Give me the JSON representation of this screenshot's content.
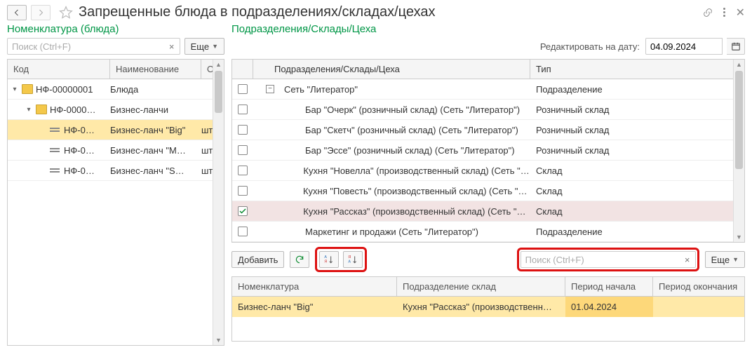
{
  "header": {
    "title": "Запрещенные блюда в подразделениях/складах/цехах"
  },
  "sections": {
    "left": "Номенклатура (блюда)",
    "right": "Подразделения/Склады/Цеха"
  },
  "search": {
    "placeholder": "Поиск (Ctrl+F)",
    "clear": "×"
  },
  "more_label": "Еще",
  "date_edit": {
    "label": "Редактировать на дату:",
    "value": "04.09.2024"
  },
  "left_grid": {
    "headers": {
      "code": "Код",
      "name": "Наименование",
      "unit": "Осн"
    },
    "rows": [
      {
        "indent": 0,
        "exp": "▾",
        "icon": "folder",
        "code": "НФ-00000001",
        "name": "Блюда",
        "unit": ""
      },
      {
        "indent": 1,
        "exp": "▾",
        "icon": "folder",
        "code": "НФ-0000…",
        "name": "Бизнес-ланчи",
        "unit": ""
      },
      {
        "indent": 2,
        "exp": "",
        "icon": "item",
        "code": "НФ-0…",
        "name": "Бизнес-ланч \"Big\"",
        "unit": "шт",
        "selected": true
      },
      {
        "indent": 2,
        "exp": "",
        "icon": "item",
        "code": "НФ-0…",
        "name": "Бизнес-ланч \"M…",
        "unit": "шт"
      },
      {
        "indent": 2,
        "exp": "",
        "icon": "item",
        "code": "НФ-0…",
        "name": "Бизнес-ланч \"S…",
        "unit": "шт"
      }
    ]
  },
  "upper_grid": {
    "headers": {
      "name": "Подразделения/Склады/Цеха",
      "type": "Тип"
    },
    "rows": [
      {
        "checked": false,
        "header": true,
        "indent": 0,
        "name": "Сеть \"Литератор\"",
        "type": "Подразделение"
      },
      {
        "checked": false,
        "indent": 1,
        "name": "Бар \"Очерк\" (розничный склад)  (Сеть \"Литератор\")",
        "type": "Розничный склад"
      },
      {
        "checked": false,
        "indent": 1,
        "name": "Бар \"Скетч\" (розничный склад)  (Сеть \"Литератор\")",
        "type": "Розничный склад"
      },
      {
        "checked": false,
        "indent": 1,
        "name": "Бар \"Эссе\" (розничный склад)  (Сеть \"Литератор\")",
        "type": "Розничный склад"
      },
      {
        "checked": false,
        "indent": 1,
        "name": "Кухня \"Новелла\" (производственный склад)  (Сеть \"Ли…",
        "type": "Склад"
      },
      {
        "checked": false,
        "indent": 1,
        "name": "Кухня \"Повесть\" (производственный склад)  (Сеть \"Лит…",
        "type": "Склад"
      },
      {
        "checked": true,
        "indent": 1,
        "name": "Кухня \"Рассказ\" (производственный склад)  (Сеть \"Лит…",
        "type": "Склад",
        "selected": true
      },
      {
        "checked": false,
        "indent": 1,
        "name": "Маркетинг и продажи (Сеть \"Литератор\")",
        "type": "Подразделение"
      }
    ]
  },
  "mid_toolbar": {
    "add": "Добавить"
  },
  "lower_grid": {
    "headers": {
      "nom": "Номенклатура",
      "dep": "Подразделение склад",
      "from": "Период начала",
      "to": "Период окончания"
    },
    "rows": [
      {
        "nom": "Бизнес-ланч \"Big\"",
        "dep": "Кухня \"Рассказ\" (производственн…",
        "from": "01.04.2024",
        "to": ""
      }
    ]
  }
}
